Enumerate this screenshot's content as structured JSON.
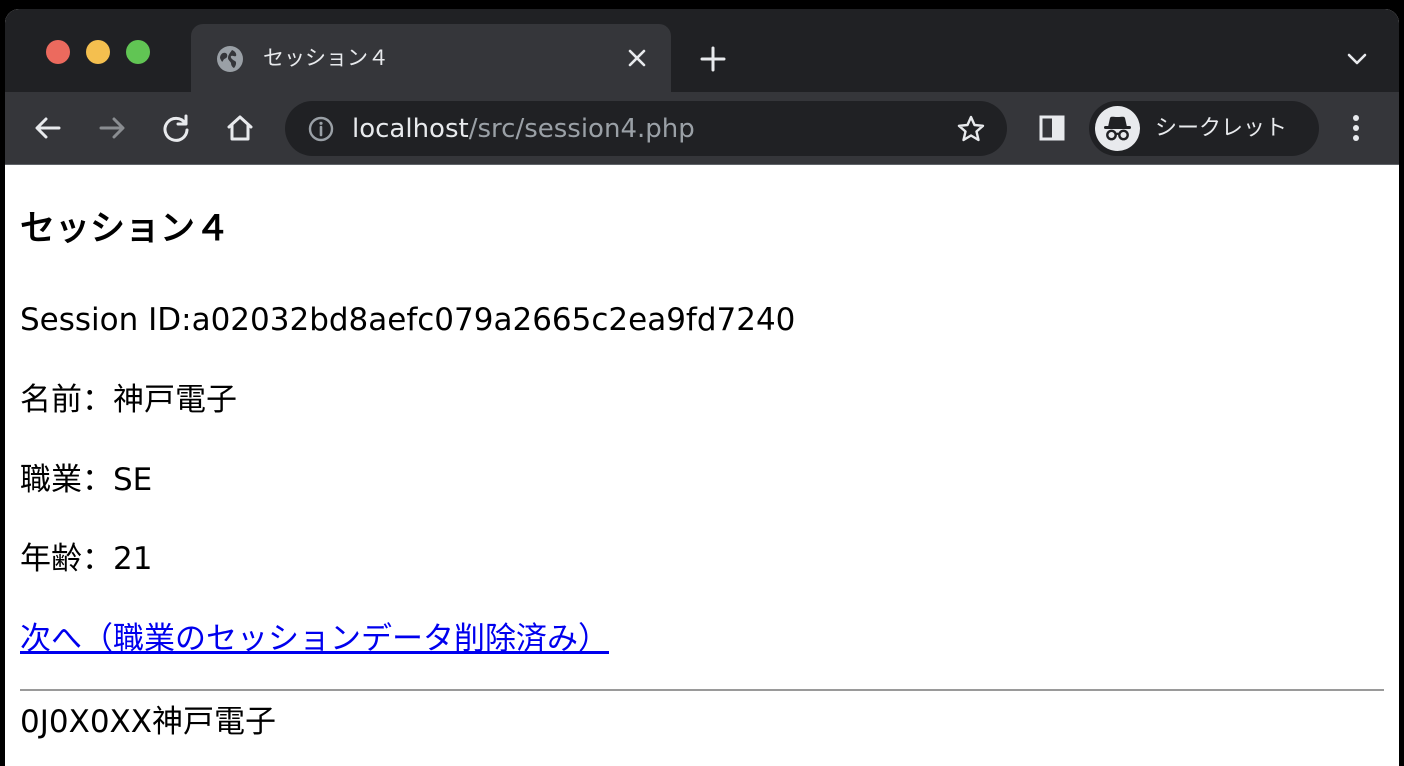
{
  "browser": {
    "tab_title": "セッション４",
    "url_host": "localhost",
    "url_path": "/src/session4.php",
    "incognito_label": "シークレット"
  },
  "page": {
    "heading": "セッション４",
    "session_id": "Session ID:a02032bd8aefc079a2665c2ea9fd7240",
    "name": "名前：神戸電子",
    "job": "職業：SE",
    "age": "年齢：21",
    "next_link": "次へ（職業のセッションデータ削除済み）",
    "footer": "0J0X0XX神戸電子"
  },
  "colors": {
    "tabbar_bg": "#202124",
    "toolbar_bg": "#35363a",
    "link": "#0000ee"
  }
}
